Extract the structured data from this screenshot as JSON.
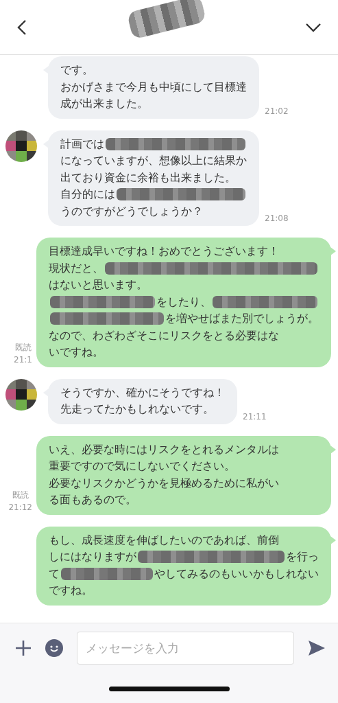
{
  "header": {
    "title_redacted": true
  },
  "messages": [
    {
      "kind": "in",
      "avatar": false,
      "time": "21:02",
      "lines": [
        [
          {
            "kind": "text",
            "text": "です。"
          }
        ],
        [
          {
            "kind": "text",
            "text": "おかげさまで今月も中頃にして目標達"
          }
        ],
        [
          {
            "kind": "text",
            "text": "成が出来ました。"
          }
        ]
      ]
    },
    {
      "kind": "in",
      "avatar": true,
      "time": "21:08",
      "lines": [
        [
          {
            "kind": "text",
            "text": "計画では"
          },
          {
            "kind": "redaction"
          }
        ],
        [
          {
            "kind": "text",
            "text": "になっていますが、想像以上に結果か"
          }
        ],
        [
          {
            "kind": "text",
            "text": "出ており資金に余裕も出来ました。"
          }
        ],
        [
          {
            "kind": "text",
            "text": "自分的には"
          },
          {
            "kind": "redaction"
          }
        ],
        [
          {
            "kind": "text",
            "text": "うのですがどうでしょうか？"
          }
        ]
      ]
    },
    {
      "kind": "out",
      "read": "既読",
      "time": "21:1",
      "lines": [
        [
          {
            "kind": "text",
            "text": "目標達成早いですね！おめでとうございます！"
          }
        ],
        [
          {
            "kind": "text",
            "text": "現状だと、"
          },
          {
            "kind": "redaction"
          }
        ],
        [
          {
            "kind": "text",
            "text": "はないと思います。"
          }
        ],
        [
          {
            "kind": "redaction"
          },
          {
            "kind": "text",
            "text": "をしたり、"
          },
          {
            "kind": "redaction"
          }
        ],
        [
          {
            "kind": "redaction"
          },
          {
            "kind": "text",
            "text": "を増やせばまた別でしょうが。"
          }
        ],
        [
          {
            "kind": "text",
            "text": "なので、わざわざそこにリスクをとる必要はな"
          }
        ],
        [
          {
            "kind": "text",
            "text": "いですね。"
          }
        ]
      ]
    },
    {
      "kind": "in",
      "avatar": true,
      "time": "21:11",
      "lines": [
        [
          {
            "kind": "text",
            "text": "そうですか、確かにそうですね！"
          }
        ],
        [
          {
            "kind": "text",
            "text": "先走ってたかもしれないです。"
          }
        ]
      ]
    },
    {
      "kind": "out",
      "read": "既読",
      "time": "21:12",
      "lines": [
        [
          {
            "kind": "text",
            "text": "いえ、必要な時にはリスクをとれるメンタルは"
          }
        ],
        [
          {
            "kind": "text",
            "text": "重要ですので気にしないでください。"
          }
        ],
        [
          {
            "kind": "text",
            "text": "必要なリスクかどうかを見極めるために私がい"
          }
        ],
        [
          {
            "kind": "text",
            "text": "る面もあるので。"
          }
        ]
      ]
    },
    {
      "kind": "out",
      "lines": [
        [
          {
            "kind": "text",
            "text": "もし、成長速度を伸ばしたいのであれば、前倒"
          }
        ],
        [
          {
            "kind": "text",
            "text": "しにはなりますが"
          },
          {
            "kind": "redaction"
          },
          {
            "kind": "text",
            "text": "を行っ"
          }
        ],
        [
          {
            "kind": "text",
            "text": "て"
          },
          {
            "kind": "redaction"
          },
          {
            "kind": "text",
            "text": "やしてみるのもいいかもしれない"
          }
        ],
        [
          {
            "kind": "text",
            "text": "ですね。"
          }
        ]
      ]
    }
  ],
  "composer": {
    "placeholder": "メッセージを入力"
  }
}
